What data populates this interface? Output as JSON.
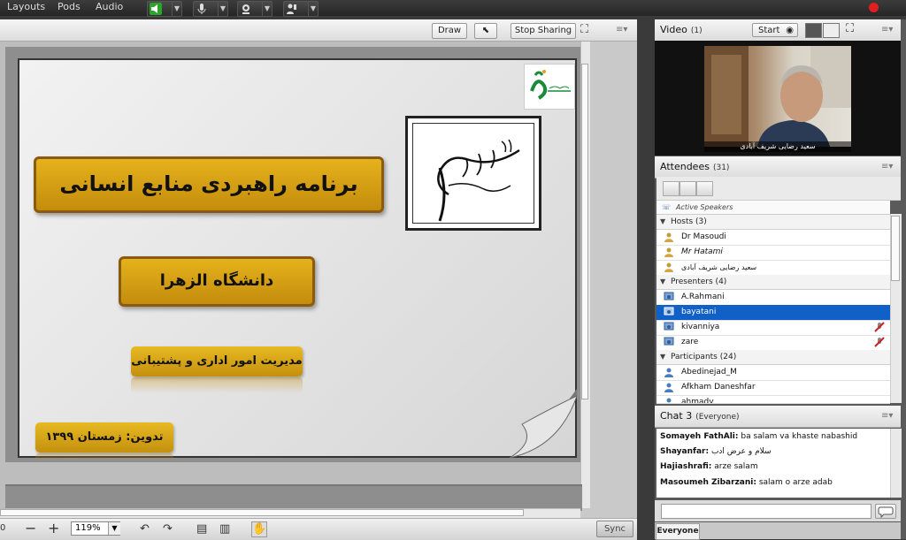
{
  "menubar": {
    "items": [
      "Layouts",
      "Pods",
      "Audio"
    ]
  },
  "share": {
    "draw_label": "Draw",
    "stop_sharing_label": "Stop Sharing",
    "zoom_value": "119%",
    "sync_label": "Sync",
    "page_indicator": "0"
  },
  "slide": {
    "title": "برنامه راهبردی منابع انسانی",
    "university": "دانشگاه الزهرا",
    "department": "مدیریت امور اداری و پشتیبانی",
    "compiled": "تدوین: زمستان ۱۳۹۹"
  },
  "video": {
    "title": "Video",
    "count": "(1)",
    "start_label": "Start",
    "speaker_name": "سعید رضایی شریف آبادی"
  },
  "attendees": {
    "title": "Attendees",
    "count": "(31)",
    "active_speakers_label": "Active Speakers",
    "groups": [
      {
        "label": "Hosts (3)",
        "members": [
          "Dr Masoudi",
          "Mr Hatami",
          "سعید رضایی شریف آبادی"
        ]
      },
      {
        "label": "Presenters (4)",
        "members": [
          "A.Rahmani",
          "bayatani",
          "kivanniya",
          "zare"
        ]
      },
      {
        "label": "Participants (24)",
        "members": [
          "Abedinejad_M",
          "Afkham Daneshfar",
          "ahmady"
        ]
      }
    ],
    "selected_member": "bayatani"
  },
  "chat": {
    "title": "Chat 3",
    "scope": "(Everyone)",
    "messages": [
      {
        "sender": "Somayeh FathAli:",
        "text": " ba salam va khaste nabashid"
      },
      {
        "sender": "Shayanfar:",
        "text": " سلام و عرض ادب"
      },
      {
        "sender": "Hajiashrafi:",
        "text": " arze salam"
      },
      {
        "sender": "Masoumeh Zibarzani:",
        "text": " salam o arze adab"
      }
    ],
    "tab_label": "Everyone"
  },
  "colors": {
    "accent_selected": "#1060c8",
    "gold": "#d7a015",
    "record": "#e02020"
  },
  "icons": [
    "speaker-icon",
    "microphone-icon",
    "webcam-icon",
    "share-status-icon",
    "fullscreen-icon",
    "pod-menu-icon",
    "user-icon",
    "presenter-icon",
    "host-icon",
    "chat-send-icon"
  ]
}
